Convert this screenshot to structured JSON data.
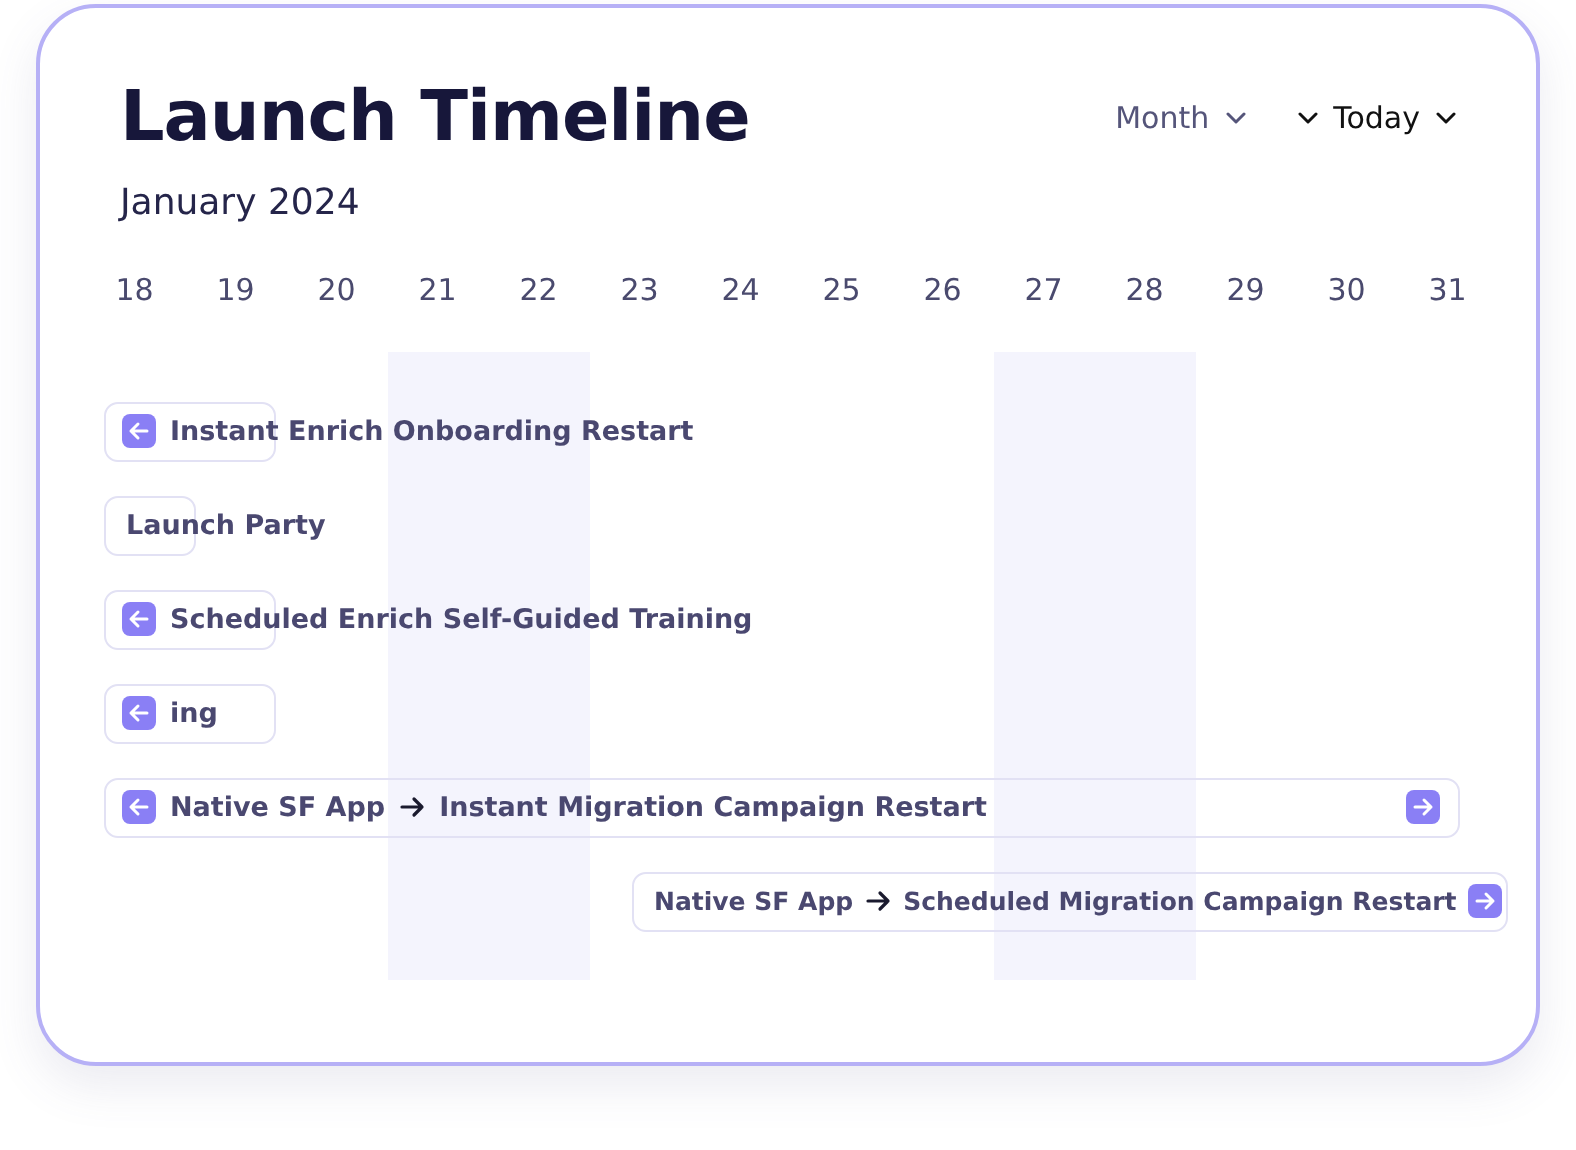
{
  "title": "Launch Timeline",
  "month_label": "January 2024",
  "controls": [
    {
      "kind": "view",
      "label": "Month"
    },
    {
      "kind": "jump",
      "label": "Today"
    }
  ],
  "days": [
    {
      "label": "18",
      "shaded": false
    },
    {
      "label": "19",
      "shaded": false
    },
    {
      "label": "20",
      "shaded": false
    },
    {
      "label": "21",
      "shaded": true
    },
    {
      "label": "22",
      "shaded": true
    },
    {
      "label": "23",
      "shaded": false
    },
    {
      "label": "24",
      "shaded": false
    },
    {
      "label": "25",
      "shaded": false
    },
    {
      "label": "26",
      "shaded": false
    },
    {
      "label": "27",
      "shaded": true
    },
    {
      "label": "28",
      "shaded": true
    },
    {
      "label": "29",
      "shaded": false
    },
    {
      "label": "30",
      "shaded": false
    },
    {
      "label": "31",
      "shaded": false
    }
  ],
  "events": [
    {
      "kind": "short",
      "label": "Instant Enrich Onboarding Restart",
      "arrow_left": true,
      "arrow_right": false
    },
    {
      "kind": "single",
      "label": "Launch Party",
      "arrow_left": false,
      "arrow_right": false
    },
    {
      "kind": "short",
      "label": "Scheduled Enrich Self-Guided Training",
      "arrow_left": true,
      "arrow_right": false
    },
    {
      "kind": "short",
      "label": "ing",
      "arrow_left": true,
      "arrow_right": false
    },
    {
      "kind": "full",
      "source": "Native SF App",
      "label": "Instant Migration Campaign Restart",
      "arrow_left": true,
      "arrow_right": true
    },
    {
      "kind": "tail",
      "source": "Native SF App",
      "label": "Scheduled Migration Campaign Restart",
      "arrow_left": false,
      "arrow_right": true
    }
  ]
}
